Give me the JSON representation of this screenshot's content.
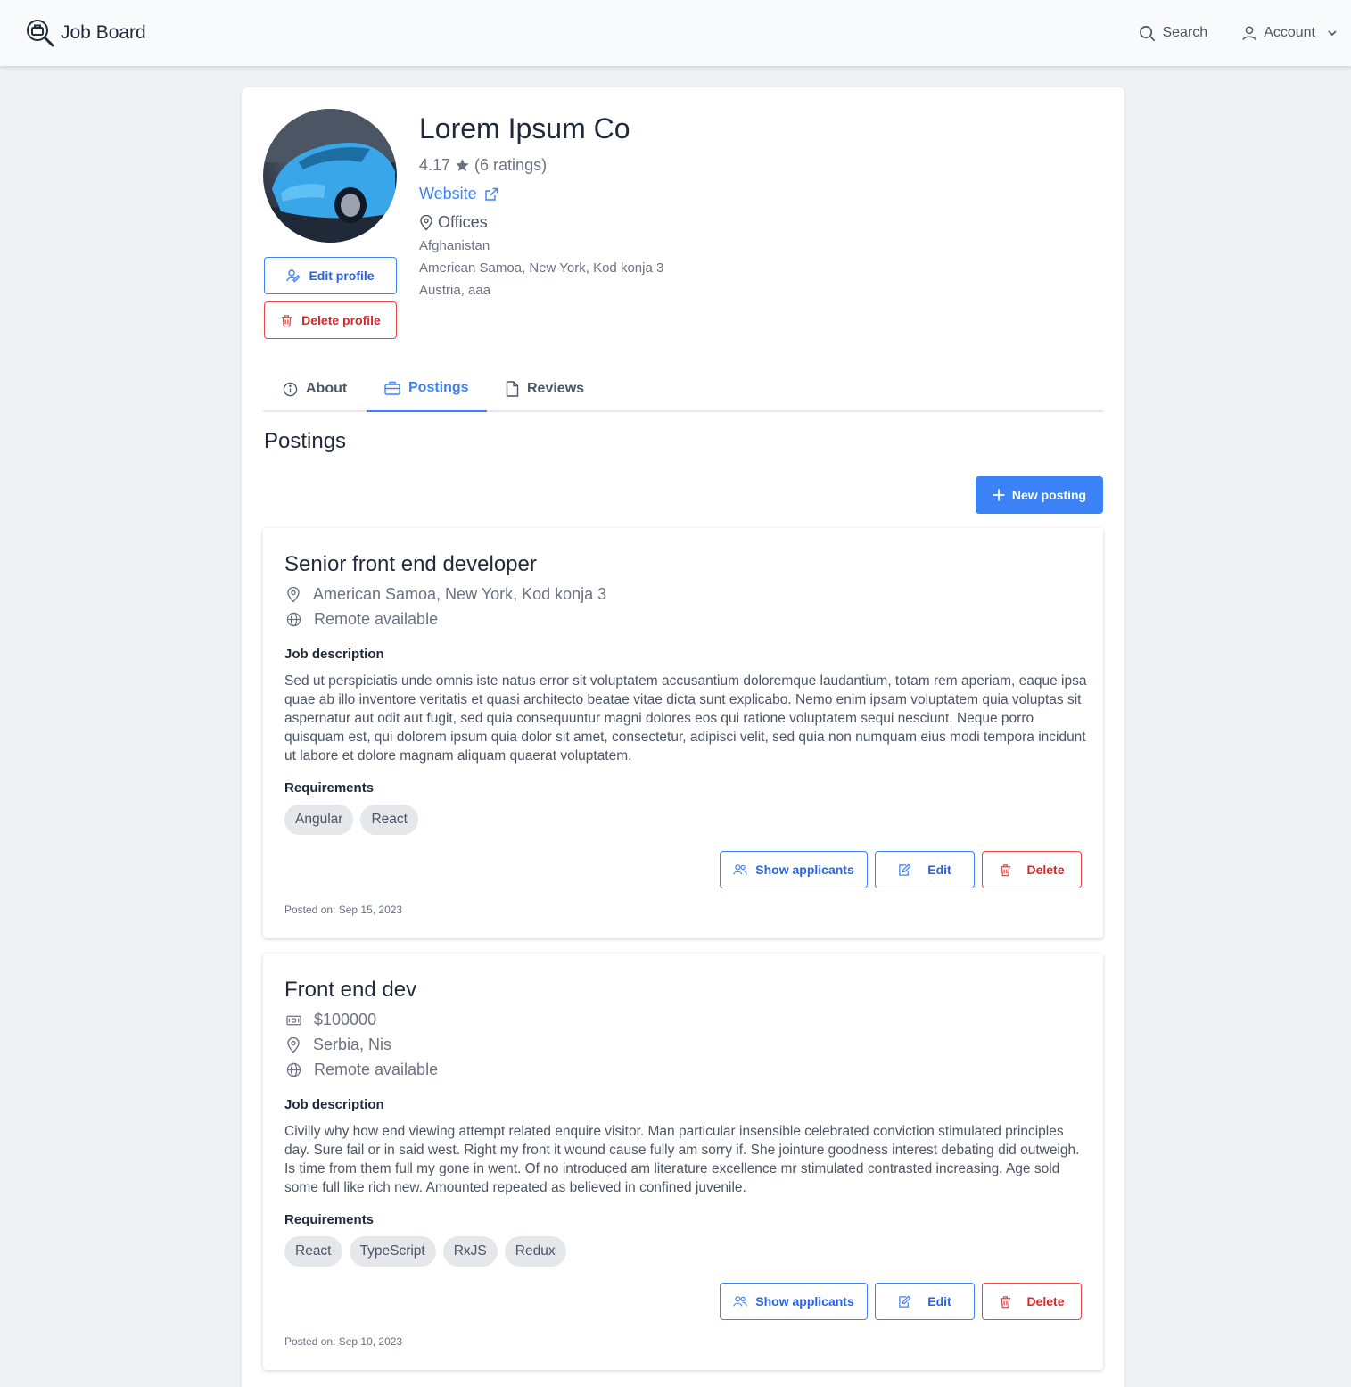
{
  "nav": {
    "brand": "Job Board",
    "search_label": "Search",
    "account_label": "Account"
  },
  "company": {
    "name": "Lorem Ipsum Co",
    "rating": "4.17",
    "ratings_count": "(6 ratings)",
    "website_label": "Website",
    "offices_label": "Offices",
    "offices": [
      "Afghanistan",
      "American Samoa, New York, Kod konja 3",
      "Austria, aaa"
    ],
    "edit_label": "Edit profile",
    "delete_label": "Delete profile"
  },
  "tabs": [
    {
      "label": "About",
      "icon": "info-icon"
    },
    {
      "label": "Postings",
      "icon": "briefcase-icon",
      "active": true
    },
    {
      "label": "Reviews",
      "icon": "document-icon"
    }
  ],
  "section_title": "Postings",
  "new_posting_label": "New posting",
  "labels": {
    "job_description": "Job description",
    "requirements": "Requirements",
    "show_applicants": "Show applicants",
    "edit": "Edit",
    "delete": "Delete"
  },
  "postings": [
    {
      "title": "Senior front end developer",
      "location": "American Samoa, New York, Kod konja 3",
      "remote": "Remote available",
      "description": "Sed ut perspiciatis unde omnis iste natus error sit voluptatem accusantium doloremque laudantium, totam rem aperiam, eaque ipsa quae ab illo inventore veritatis et quasi architecto beatae vitae dicta sunt explicabo. Nemo enim ipsam voluptatem quia voluptas sit aspernatur aut odit aut fugit, sed quia consequuntur magni dolores eos qui ratione voluptatem sequi nesciunt. Neque porro quisquam est, qui dolorem ipsum quia dolor sit amet, consectetur, adipisci velit, sed quia non numquam eius modi tempora incidunt ut labore et dolore magnam aliquam quaerat voluptatem.",
      "requirements": [
        "Angular",
        "React"
      ],
      "posted": "Posted on: Sep 15, 2023"
    },
    {
      "title": "Front end dev",
      "salary": "$100000",
      "location": "Serbia, Nis",
      "remote": "Remote available",
      "description": "Civilly why how end viewing attempt related enquire visitor. Man particular insensible celebrated conviction stimulated principles day. Sure fail or in said west. Right my front it wound cause fully am sorry if. She jointure goodness interest debating did outweigh. Is time from them full my gone in went. Of no introduced am literature excellence mr stimulated contrasted increasing. Age sold some full like rich new. Amounted repeated as believed in confined juvenile.",
      "requirements": [
        "React",
        "TypeScript",
        "RxJS",
        "Redux"
      ],
      "posted": "Posted on: Sep 10, 2023"
    }
  ],
  "colors": {
    "primary": "#3b82f6",
    "danger": "#ef4444",
    "background": "#eef0f3"
  }
}
